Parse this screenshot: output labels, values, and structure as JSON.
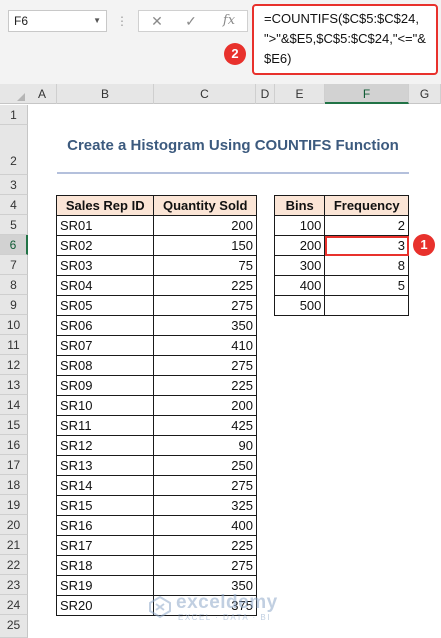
{
  "formula_bar": {
    "name_box": "F6",
    "cancel_icon": "✕",
    "enter_icon": "✓",
    "fx_label": "fx",
    "formula": "=COUNTIFS($C$5:$C$24,\n\">\"&$E5,$C$5:$C$24,\"<=\"&\n$E6)"
  },
  "callouts": {
    "formula_marker": "2",
    "cell_marker": "1"
  },
  "columns": [
    "A",
    "B",
    "C",
    "D",
    "E",
    "F",
    "G"
  ],
  "selected_column": "F",
  "rows": [
    "1",
    "2",
    "3",
    "4",
    "5",
    "6",
    "7",
    "8",
    "9",
    "10",
    "11",
    "12",
    "13",
    "14",
    "15",
    "16",
    "17",
    "18",
    "19",
    "20",
    "21",
    "22",
    "23",
    "24",
    "25"
  ],
  "selected_row": "6",
  "title": "Create a Histogram Using COUNTIFS Function",
  "sales_table": {
    "headers": [
      "Sales Rep ID",
      "Quantity Sold"
    ],
    "rows": [
      [
        "SR01",
        "200"
      ],
      [
        "SR02",
        "150"
      ],
      [
        "SR03",
        "75"
      ],
      [
        "SR04",
        "225"
      ],
      [
        "SR05",
        "275"
      ],
      [
        "SR06",
        "350"
      ],
      [
        "SR07",
        "410"
      ],
      [
        "SR08",
        "275"
      ],
      [
        "SR09",
        "225"
      ],
      [
        "SR10",
        "200"
      ],
      [
        "SR11",
        "425"
      ],
      [
        "SR12",
        "90"
      ],
      [
        "SR13",
        "250"
      ],
      [
        "SR14",
        "275"
      ],
      [
        "SR15",
        "325"
      ],
      [
        "SR16",
        "400"
      ],
      [
        "SR17",
        "225"
      ],
      [
        "SR18",
        "275"
      ],
      [
        "SR19",
        "350"
      ],
      [
        "SR20",
        "375"
      ]
    ]
  },
  "bins_table": {
    "headers": [
      "Bins",
      "Frequency"
    ],
    "rows": [
      [
        "100",
        "2"
      ],
      [
        "200",
        "3"
      ],
      [
        "300",
        "8"
      ],
      [
        "400",
        "5"
      ],
      [
        "500",
        ""
      ]
    ]
  },
  "watermark": {
    "name": "exceldemy",
    "tagline": "EXCEL · DATA · BI"
  }
}
